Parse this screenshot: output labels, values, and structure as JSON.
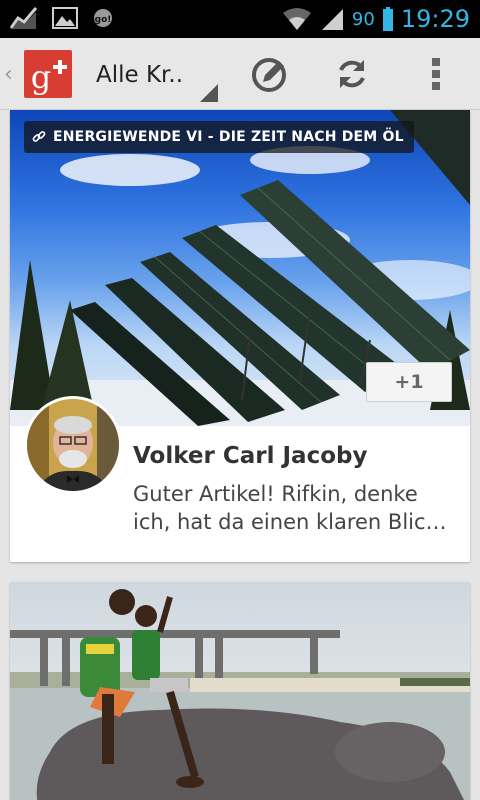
{
  "status_bar": {
    "battery_level": "90",
    "time": "19:29",
    "icons": [
      "activity-graph-icon",
      "picture-icon",
      "gol-notification-icon",
      "wifi-icon",
      "signal-icon",
      "battery-icon"
    ]
  },
  "action_bar": {
    "app": "Google+",
    "stream_label": "Alle Kr..",
    "icons": [
      "up-caret-icon",
      "compose-icon",
      "refresh-icon",
      "overflow-menu-icon"
    ]
  },
  "feed": [
    {
      "album_tag": "ENERGIEWENDE VI - DIE ZEIT NACH DEM ÖL",
      "plus_one_label": "+1",
      "author": "Volker Carl Jacoby",
      "snippet": "Guter Artikel! Rifkin, denke ich, hat da einen klaren Blick auf die Zukunft der Energie..."
    }
  ],
  "colors": {
    "accent": "#33b5e5",
    "google_plus_red": "#d73d32",
    "action_bar": "#e7e7e7",
    "background": "#e5e5e5"
  }
}
